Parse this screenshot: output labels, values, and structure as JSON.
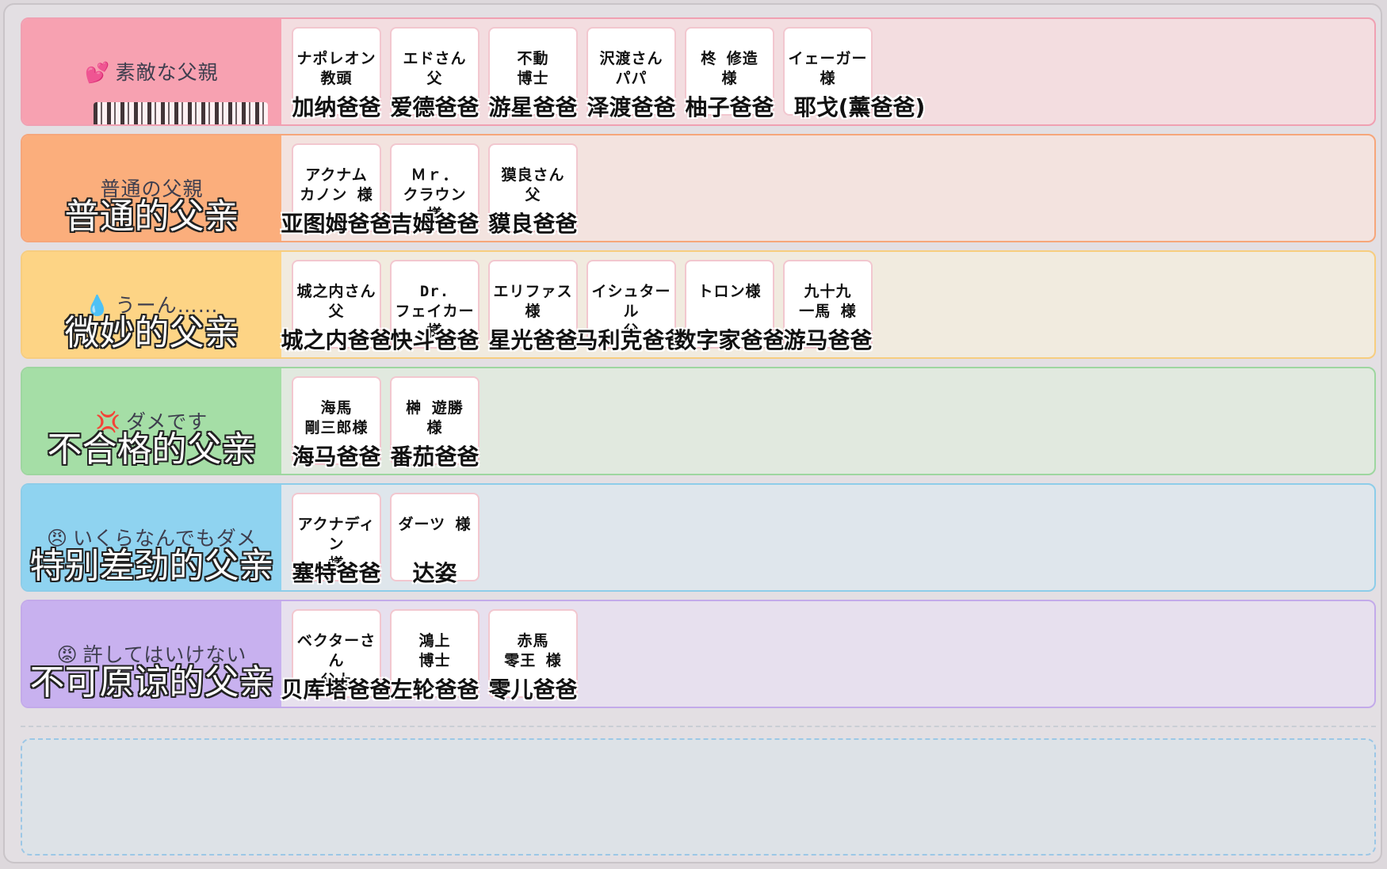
{
  "tiers": [
    {
      "label_jp": "素敵な父親",
      "emoji": "💕",
      "label_cn": "",
      "label_color": "#f7a1b1",
      "row_color": "#f3dde0",
      "border_color": "#f0a0b2",
      "cards": [
        {
          "name": "ナポレオン\n教頭",
          "caption": "加纳爸爸"
        },
        {
          "name": "エドさん\n父",
          "caption": "爱德爸爸"
        },
        {
          "name": "不動\n博士",
          "caption": "游星爸爸"
        },
        {
          "name": "沢渡さん\nパパ",
          "caption": "泽渡爸爸"
        },
        {
          "name": "柊 修造\n様",
          "caption": "柚子爸爸"
        },
        {
          "name": "イェーガー\n様",
          "caption": "耶戈(薰爸爸)"
        }
      ]
    },
    {
      "label_jp": "普通の父親",
      "emoji": "",
      "label_cn": "普通的父亲",
      "label_color": "#fbae7c",
      "row_color": "#f3e3df",
      "border_color": "#f6a67a",
      "cards": [
        {
          "name": "アクナム\nカノン 様",
          "caption": "亚图姆爸爸"
        },
        {
          "name": "Ｍｒ．\nクラウン 様",
          "caption": "吉姆爸爸"
        },
        {
          "name": "獏良さん\n父",
          "caption": "貘良爸爸"
        }
      ]
    },
    {
      "label_jp": "うーん……",
      "emoji": "💧",
      "label_cn": "微妙的父亲",
      "label_color": "#fdd485",
      "row_color": "#f1ebdf",
      "border_color": "#f7cd7f",
      "cards": [
        {
          "name": "城之内さん\n父",
          "caption": "城之内爸爸"
        },
        {
          "name": "Dr.\nフェイカー 様",
          "caption": "快斗爸爸"
        },
        {
          "name": "エリファス\n様",
          "caption": "星光爸爸"
        },
        {
          "name": "イシュタール\n父",
          "caption": "马利克爸爸"
        },
        {
          "name": "トロン様",
          "caption": "数字家爸爸"
        },
        {
          "name": "九十九\n一馬 様",
          "caption": "游马爸爸"
        }
      ]
    },
    {
      "label_jp": "ダメです",
      "emoji": "💢",
      "label_cn": "不合格的父亲",
      "label_color": "#a5dea6",
      "row_color": "#e1e9df",
      "border_color": "#9ed6a0",
      "cards": [
        {
          "name": "海馬\n剛三郎様",
          "caption": "海马爸爸"
        },
        {
          "name": "榊 遊勝\n様",
          "caption": "番茄爸爸"
        }
      ]
    },
    {
      "label_jp": "いくらなんでもダメ",
      "emoji": "😠",
      "label_cn": "特别差劲的父亲",
      "label_color": "#8fd3f0",
      "row_color": "#dfe6ec",
      "border_color": "#8dcde9",
      "cards": [
        {
          "name": "アクナディン\n様",
          "caption": "塞特爸爸"
        },
        {
          "name": "ダーツ 様",
          "caption": "达姿"
        }
      ]
    },
    {
      "label_jp": "許してはいけない",
      "emoji": "😡",
      "label_cn": "不可原谅的父亲",
      "label_color": "#c8b1ef",
      "row_color": "#e7e0ee",
      "border_color": "#c3aaea",
      "cards": [
        {
          "name": "ベクターさん\n父上",
          "caption": "贝库塔爸爸"
        },
        {
          "name": "鴻上\n博士",
          "caption": "左轮爸爸"
        },
        {
          "name": "赤馬\n零王 様",
          "caption": "零儿爸爸"
        }
      ]
    }
  ]
}
